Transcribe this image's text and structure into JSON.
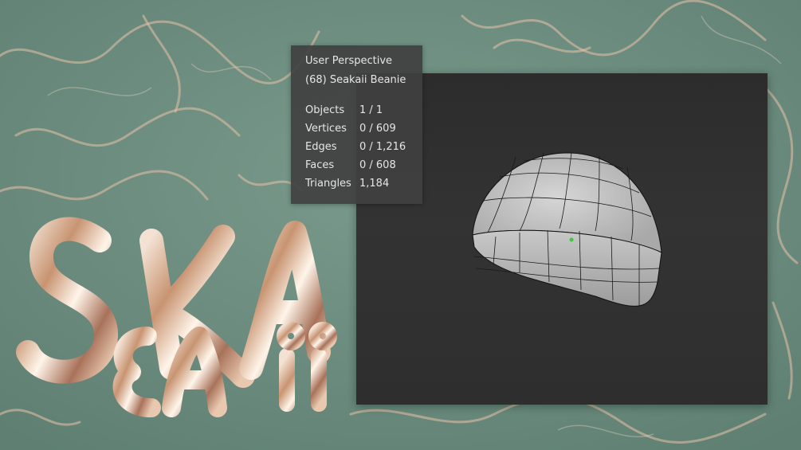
{
  "viewport": {
    "view_name": "User Perspective",
    "object_label": "(68) Seakaii Beanie",
    "stats": [
      {
        "label": "Objects",
        "value": "1 / 1"
      },
      {
        "label": "Vertices",
        "value": "0 / 609"
      },
      {
        "label": "Edges",
        "value": "0 / 1,216"
      },
      {
        "label": "Faces",
        "value": "0 / 608"
      },
      {
        "label": "Triangles",
        "value": "1,184"
      }
    ]
  },
  "logo": {
    "text_line1": "SKA",
    "text_line2": "EAii"
  },
  "colors": {
    "background_water": "#6f8f82",
    "viewport_bg": "#303030",
    "overlay_bg": "#404040",
    "mesh_fill": "#bdbdbd",
    "origin_dot": "#3cc83c"
  },
  "icons": {
    "origin": "object-origin-icon"
  }
}
